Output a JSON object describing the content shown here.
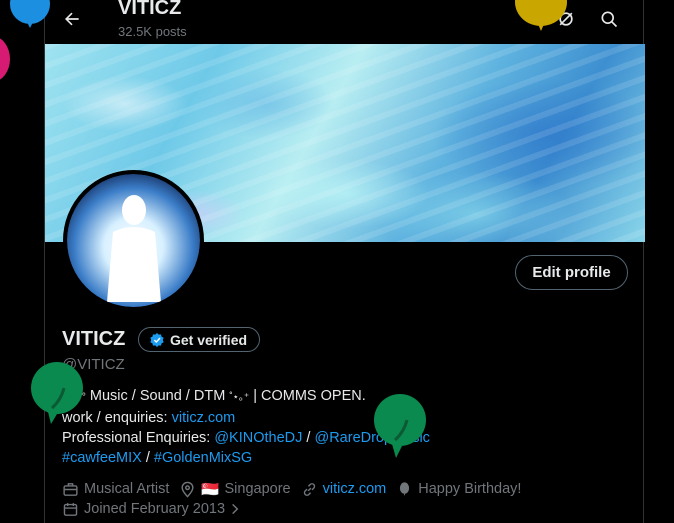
{
  "header": {
    "title": "VITICZ",
    "posts": "32.5K posts"
  },
  "profile": {
    "edit_label": "Edit profile",
    "name": "VITICZ",
    "verify_label": "Get verified",
    "handle": "@VITICZ"
  },
  "bio": {
    "line1_a": "⁺˚⋆｡°",
    "line1_b": " Music / Sound / DTM ",
    "line1_c": "˚⋆｡⁺",
    "line1_d": " | COMMS OPEN.",
    "line2_prefix": "work / enquiries: ",
    "line2_link": "viticz.com",
    "line3_prefix": "Professional Enquiries: ",
    "line3_link1": "@KINOtheDJ",
    "line3_sep": " / ",
    "line3_link2": "@RareDropMusic",
    "line4_link1": "#cawfeeMIX",
    "line4_sep": " / ",
    "line4_link2": "#GoldenMixSG"
  },
  "meta": {
    "category": "Musical Artist",
    "flag": "🇸🇬",
    "location": "Singapore",
    "website": "viticz.com",
    "birthday": "Happy Birthday!",
    "joined": "Joined February 2013"
  },
  "colors": {
    "accent": "#1d9bf0",
    "muted": "#71767b",
    "balloon_green": "#0a8a4e",
    "balloon_yellow": "#c9a600",
    "balloon_blue": "#1d8fe0",
    "balloon_pink": "#d81b72"
  }
}
